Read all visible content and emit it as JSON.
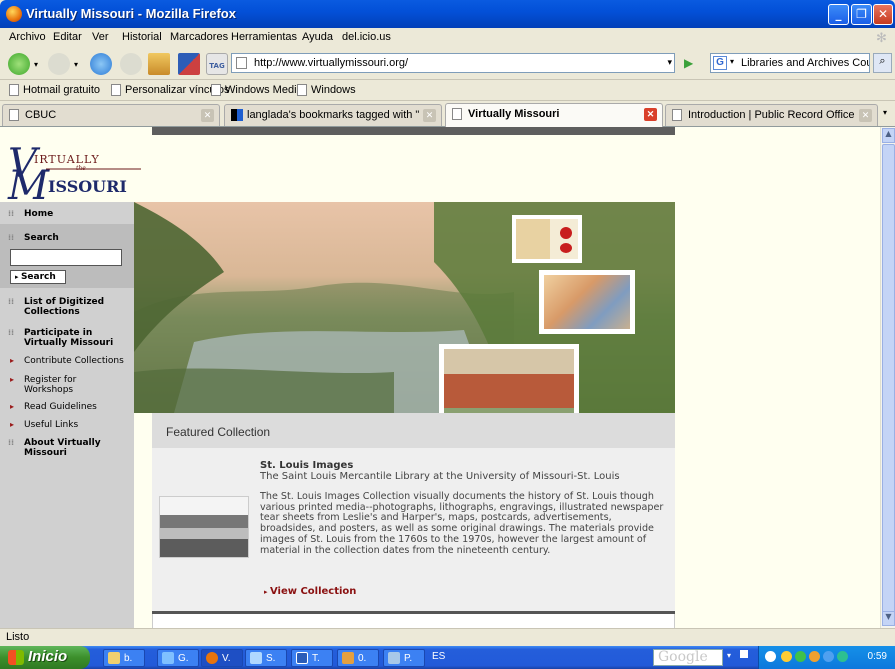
{
  "window": {
    "title": "Virtually Missouri - Mozilla Firefox"
  },
  "menu": [
    "Archivo",
    "Editar",
    "Ver",
    "Historial",
    "Marcadores",
    "Herramientas",
    "Ayuda",
    "del.icio.us"
  ],
  "nav": {
    "url": "http://www.virtuallymissouri.org/",
    "search_value": "Libraries and Archives Council,",
    "tag_label": "TAG"
  },
  "bookmarks": [
    "Hotmail gratuito",
    "Personalizar vínculos",
    "Windows Media",
    "Windows"
  ],
  "tabs": [
    {
      "label": "CBUC",
      "active": false
    },
    {
      "label": "langlada's bookmarks tagged with \"cas...",
      "active": false
    },
    {
      "label": "Virtually Missouri",
      "active": true
    },
    {
      "label": "Introduction | Public Record Office of ...",
      "active": false
    }
  ],
  "site": {
    "logo_top": "IRTUALLY",
    "logo_bottom": "ISSOURI",
    "logo_mid": "the",
    "sidebar": {
      "home": "Home",
      "search_heading": "Search",
      "search_button": "Search",
      "digitized": "List of Digitized Collections",
      "participate": "Participate in Virtually Missouri",
      "contribute": "Contribute Collections",
      "register": "Register for Workshops",
      "guidelines": "Read Guidelines",
      "links": "Useful Links",
      "about": "About Virtually Missouri"
    },
    "featured": {
      "heading": "Featured Collection",
      "title": "St. Louis Images",
      "subtitle": "The Saint Louis Mercantile Library at the University of Missouri-St. Louis",
      "description": "The St. Louis Images Collection visually documents the history of St. Louis though various printed media--photographs, lithographs, engravings, illustrated newspaper tear sheets from Leslie's and Harper's, maps, postcards, advertisements, broadsides, and posters, as well as some original drawings. The materials provide images of St. Louis from the 1760s to the 1970s, however the largest amount of material in the collection dates from the nineteenth century.",
      "link": "View Collection"
    }
  },
  "status": "Listo",
  "taskbar": {
    "start": "Inicio",
    "items": [
      "b.",
      "G.",
      "V.",
      "S.",
      "T.",
      "0.",
      "P."
    ],
    "lang": "ES",
    "google": "Google",
    "clock": "0:59"
  }
}
